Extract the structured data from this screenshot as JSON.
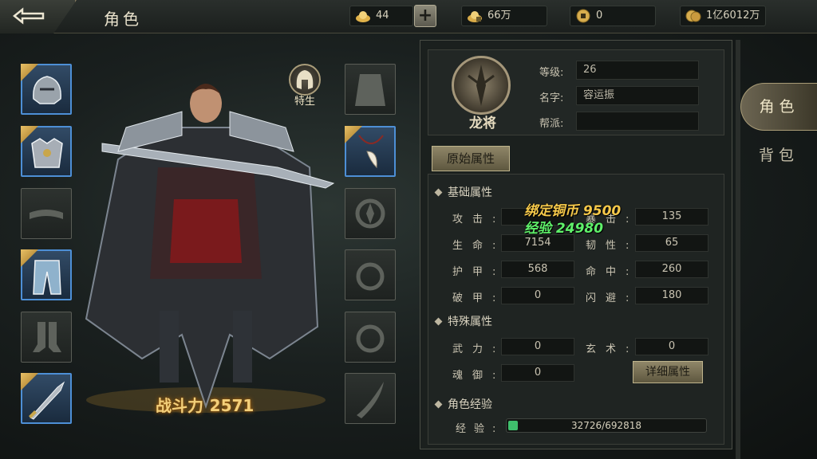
{
  "header": {
    "title": "角色"
  },
  "currencies": [
    {
      "name": "yuanbao-icon",
      "value": "44"
    },
    {
      "name": "bound-yuanbao-icon",
      "value": "66万"
    },
    {
      "name": "copper-coin-icon",
      "value": "0"
    },
    {
      "name": "bound-copper-icon",
      "value": "1亿6012万"
    }
  ],
  "character": {
    "reborn_label": "特生",
    "power_label": "战斗力",
    "power_value": "2571",
    "rank": "龙将",
    "level_label": "等级:",
    "level": "26",
    "name_label": "名字:",
    "name": "容运振",
    "guild_label": "帮派:",
    "guild": ""
  },
  "tabs": {
    "original_attributes": "原始属性"
  },
  "sections": {
    "basic": "基础属性",
    "special": "特殊属性",
    "exp": "角色经验"
  },
  "basic_attrs": [
    {
      "label": "攻击:",
      "value": ""
    },
    {
      "label": "暴击:",
      "value": "135"
    },
    {
      "label": "生命:",
      "value": "7154"
    },
    {
      "label": "韧性:",
      "value": "65"
    },
    {
      "label": "护甲:",
      "value": "568"
    },
    {
      "label": "命中:",
      "value": "260"
    },
    {
      "label": "破甲:",
      "value": "0"
    },
    {
      "label": "闪避:",
      "value": "180"
    }
  ],
  "special_attrs": [
    {
      "label": "武力:",
      "value": "0"
    },
    {
      "label": "玄术:",
      "value": "0"
    },
    {
      "label": "魂御:",
      "value": "0"
    }
  ],
  "detail_button": "详细属性",
  "exp": {
    "label": "经验:",
    "text": "32726/692818",
    "fraction": 0.047
  },
  "floating": {
    "coins": "绑定铜币 9500",
    "exp": "经验 24980"
  },
  "side_tabs": [
    "角色",
    "背包"
  ],
  "colors": {
    "accent_gold": "#f2cf7a",
    "exp_green": "#3fbf6c",
    "equip_blue": "#4d8fd6"
  }
}
